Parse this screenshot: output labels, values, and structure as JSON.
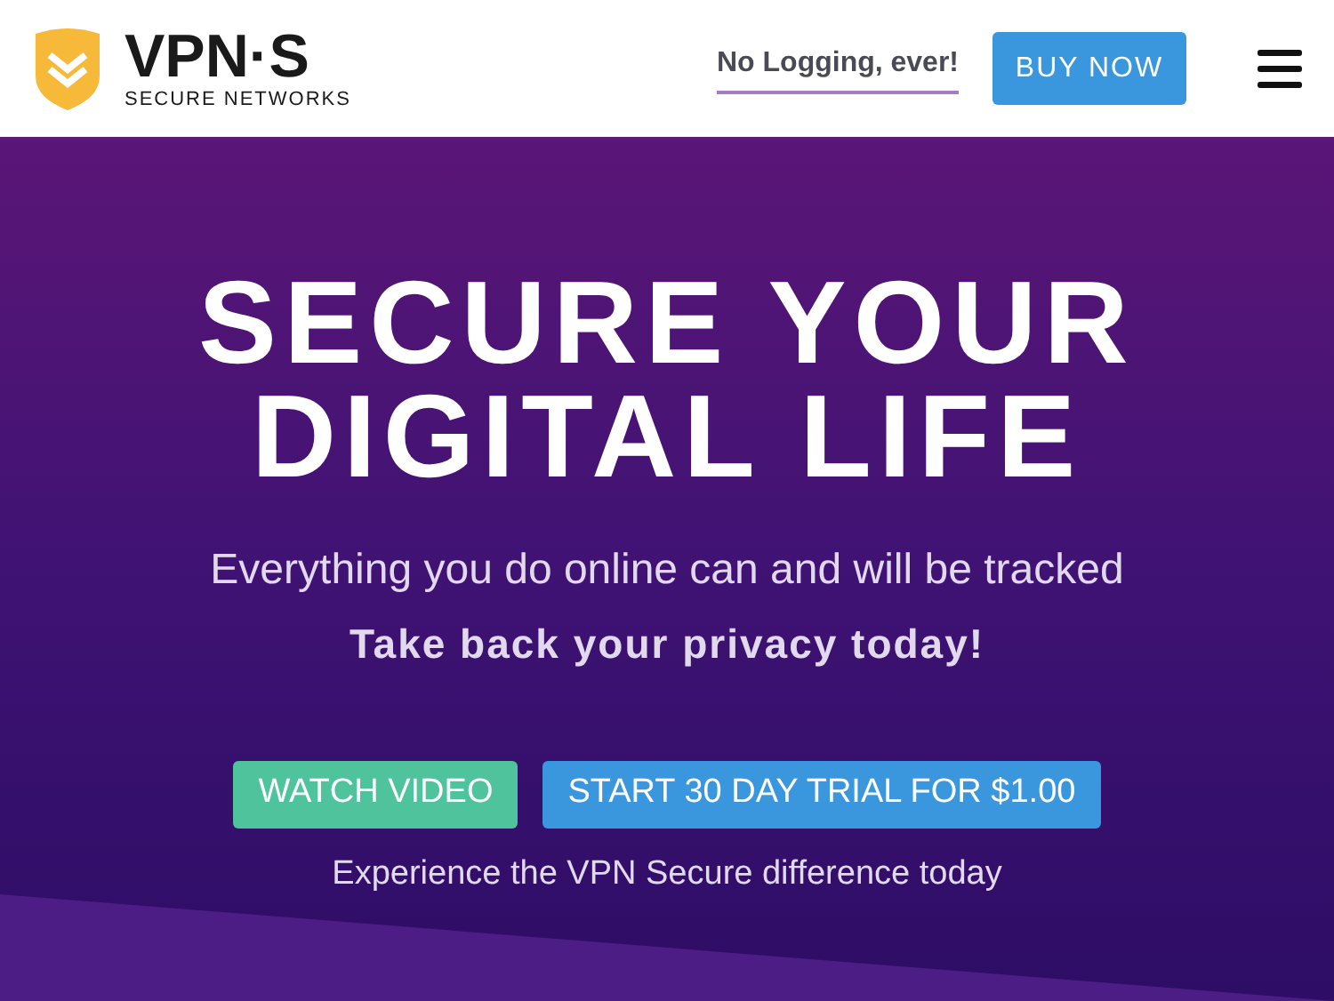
{
  "header": {
    "logo": {
      "name": "VPN·S",
      "tagline": "SECURE NETWORKS"
    },
    "link": "No Logging, ever!",
    "buy_button": "BUY NOW"
  },
  "hero": {
    "heading_lines": [
      "SECURE YOUR",
      "DIGITAL LIFE"
    ],
    "subtitle": "Everything you do online can and will be tracked",
    "emphasis": "Take back your privacy today!",
    "buttons": [
      {
        "label": "WATCH VIDEO",
        "kind": "secondary"
      },
      {
        "label": "START 30 DAY TRIAL FOR $1.00",
        "kind": "primary"
      }
    ],
    "note": "Experience the VPN Secure difference today"
  }
}
